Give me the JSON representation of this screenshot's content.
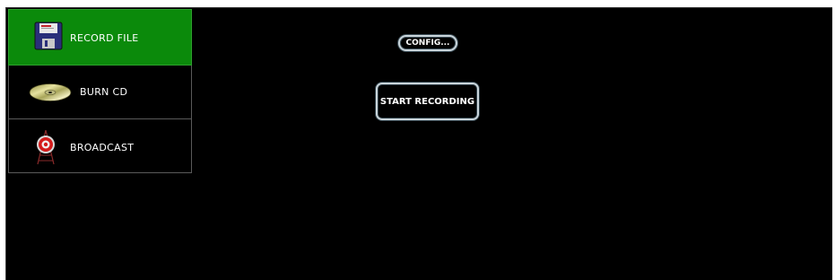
{
  "sidebar": {
    "items": [
      {
        "label": "RECORD FILE",
        "icon": "floppy-disk-icon",
        "active": true
      },
      {
        "label": "BURN CD",
        "icon": "compact-disc-icon",
        "active": false
      },
      {
        "label": "BROADCAST",
        "icon": "broadcast-tower-icon",
        "active": false
      }
    ]
  },
  "main": {
    "config_label": "CONFIG...",
    "start_label": "START RECORDING"
  },
  "colors": {
    "active_item": "#0b8a0b",
    "background": "#000000",
    "button_border": "#c9d4da"
  }
}
